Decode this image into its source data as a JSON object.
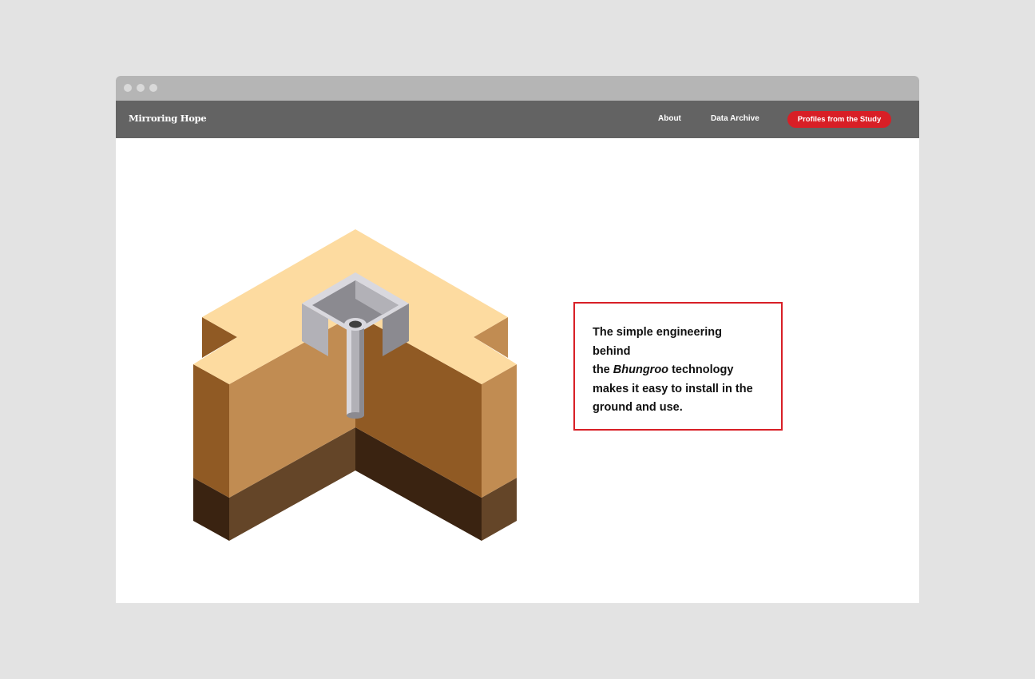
{
  "window": {
    "dots": [
      "close",
      "minimize",
      "maximize"
    ]
  },
  "nav": {
    "site_title": "Mirroring Hope",
    "about_label": "About",
    "archive_label": "Data Archive",
    "cta_label": "Profiles from the Study"
  },
  "illustration": {
    "icon": "bhungroo-cutaway-illustration",
    "colors": {
      "soil_top": "#fddba0",
      "soil_light": "#c18c52",
      "soil_dark": "#905a24",
      "subsoil_light": "#644528",
      "subsoil_dark": "#3a2311",
      "pipe_light": "#d9d8de",
      "pipe_mid": "#b2b1b7",
      "pipe_dark": "#8b8a90"
    }
  },
  "caption": {
    "line1": "The simple engineering",
    "line2": "behind",
    "line3_before": "the ",
    "line3_emphasis": "Bhungroo",
    "line3_after": " technology",
    "line4": "makes it easy to install in the",
    "line5": "ground and use."
  },
  "colors": {
    "accent": "#d81f26",
    "navbar": "#636363",
    "titlebar": "#b5b5b5",
    "backdrop": "#e3e3e3"
  }
}
